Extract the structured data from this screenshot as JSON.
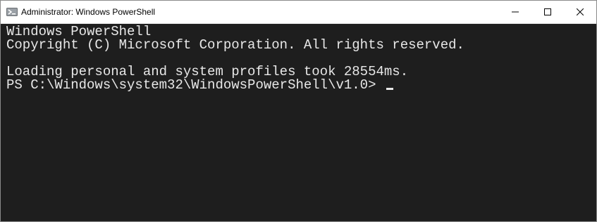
{
  "window": {
    "title": "Administrator: Windows PowerShell",
    "app_icon": "powershell-icon",
    "controls": {
      "minimize_icon": "minimize-icon",
      "maximize_icon": "maximize-icon",
      "close_icon": "close-icon"
    }
  },
  "console": {
    "lines": [
      "Windows PowerShell",
      "Copyright (C) Microsoft Corporation. All rights reserved.",
      "",
      "Loading personal and system profiles took 28554ms."
    ],
    "prompt": "PS C:\\Windows\\system32\\WindowsPowerShell\\v1.0> "
  },
  "colors": {
    "console_background": "#1e1e1e",
    "console_text": "#e8e8e8",
    "titlebar_background": "#ffffff"
  }
}
